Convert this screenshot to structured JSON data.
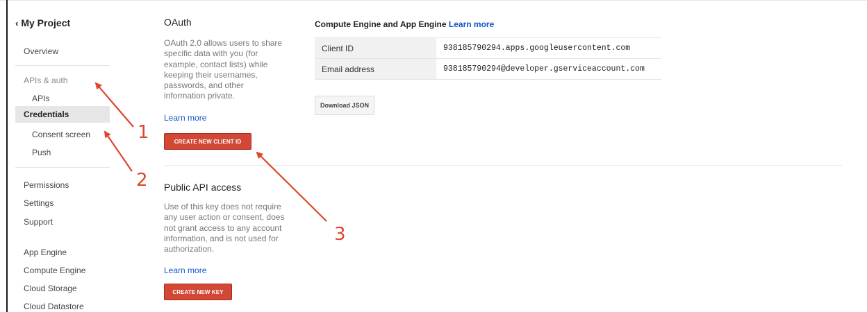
{
  "sidebar": {
    "back_label": "My Project",
    "items": [
      {
        "label": "Overview"
      },
      {
        "label": "APIs & auth"
      },
      {
        "label": "APIs"
      },
      {
        "label": "Credentials"
      },
      {
        "label": "Consent screen"
      },
      {
        "label": "Push"
      },
      {
        "label": "Permissions"
      },
      {
        "label": "Settings"
      },
      {
        "label": "Support"
      },
      {
        "label": "App Engine"
      },
      {
        "label": "Compute Engine"
      },
      {
        "label": "Cloud Storage"
      },
      {
        "label": "Cloud Datastore"
      }
    ]
  },
  "oauth": {
    "title": "OAuth",
    "description_lines": [
      "OAuth 2.0 allows users to share",
      "specific data with you (for",
      "example, contact lists) while",
      "keeping their usernames,",
      "passwords, and other",
      "information private."
    ],
    "learn_more": "Learn more",
    "button": "CREATE NEW CLIENT ID"
  },
  "public_api": {
    "title": "Public API access",
    "description_lines": [
      "Use of this key does not require",
      "any user action or consent, does",
      "not grant access to any account",
      "information, and is not used for",
      "authorization."
    ],
    "learn_more": "Learn more",
    "button": "CREATE NEW KEY"
  },
  "compute_engine": {
    "title": "Compute Engine and App Engine",
    "learn_more": "Learn more",
    "rows": [
      {
        "key": "Client ID",
        "value": "938185790294.apps.googleusercontent.com"
      },
      {
        "key": "Email address",
        "value": "938185790294@developer.gserviceaccount.com"
      }
    ],
    "download_button": "Download JSON"
  },
  "annotations": {
    "labels": [
      "1",
      "2",
      "3"
    ],
    "color": "#e0452b"
  }
}
